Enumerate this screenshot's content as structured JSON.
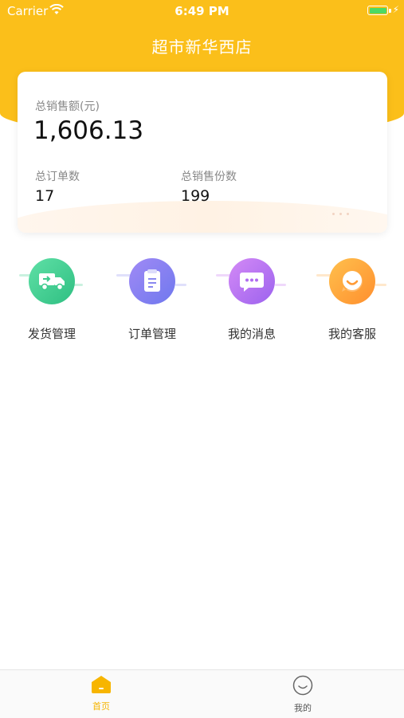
{
  "status_bar": {
    "carrier": "Carrier",
    "time": "6:49 PM"
  },
  "header": {
    "title": "超市新华西店"
  },
  "stats": {
    "total_sales_label": "总销售额(元)",
    "total_sales_value": "1,606.13",
    "total_orders_label": "总订单数",
    "total_orders_value": "17",
    "total_items_label": "总销售份数",
    "total_items_value": "199"
  },
  "menu": [
    {
      "label": "发货管理",
      "icon": "delivery-truck-icon",
      "color": "#3DCB8E"
    },
    {
      "label": "订单管理",
      "icon": "document-icon",
      "color": "#7B7BEF"
    },
    {
      "label": "我的消息",
      "icon": "message-bubble-icon",
      "color": "#B86CF0"
    },
    {
      "label": "我的客服",
      "icon": "smiley-service-icon",
      "color": "#FFA33A"
    }
  ],
  "tabbar": {
    "home_label": "首页",
    "mine_label": "我的",
    "active_color": "#F5B400",
    "inactive_color": "#666666"
  },
  "colors": {
    "brand": "#FBBF1A"
  }
}
